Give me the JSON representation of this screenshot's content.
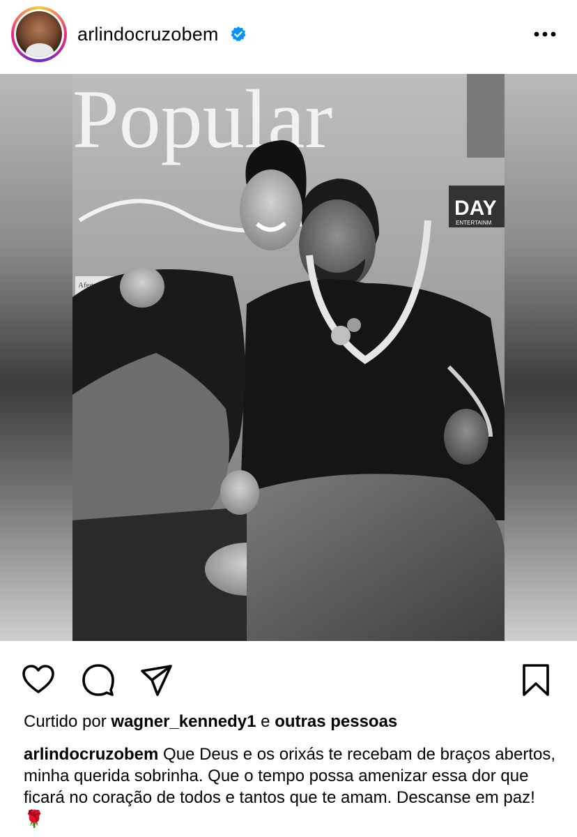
{
  "header": {
    "username": "arlindocruzobem"
  },
  "likes": {
    "prefix": "Curtido por",
    "user": "wagner_kennedy1",
    "connector": "e",
    "others": "outras pessoas"
  },
  "caption": {
    "username": "arlindocruzobem",
    "text": "Que Deus e os orixás te recebam de braços abertos, minha querida sobrinha. Que o tempo possa amenizar essa dor que ficará no coração de todos e tantos que te amam. Descanse em paz! 🌹"
  },
  "photo": {
    "backdrop_text": "Popular",
    "backdrop_logo": "DAY",
    "backdrop_logo_sub": "ENTERTAINM",
    "poster_text": "Afeganou Popular"
  },
  "colors": {
    "verified": "#0095f6",
    "text": "#000000"
  }
}
